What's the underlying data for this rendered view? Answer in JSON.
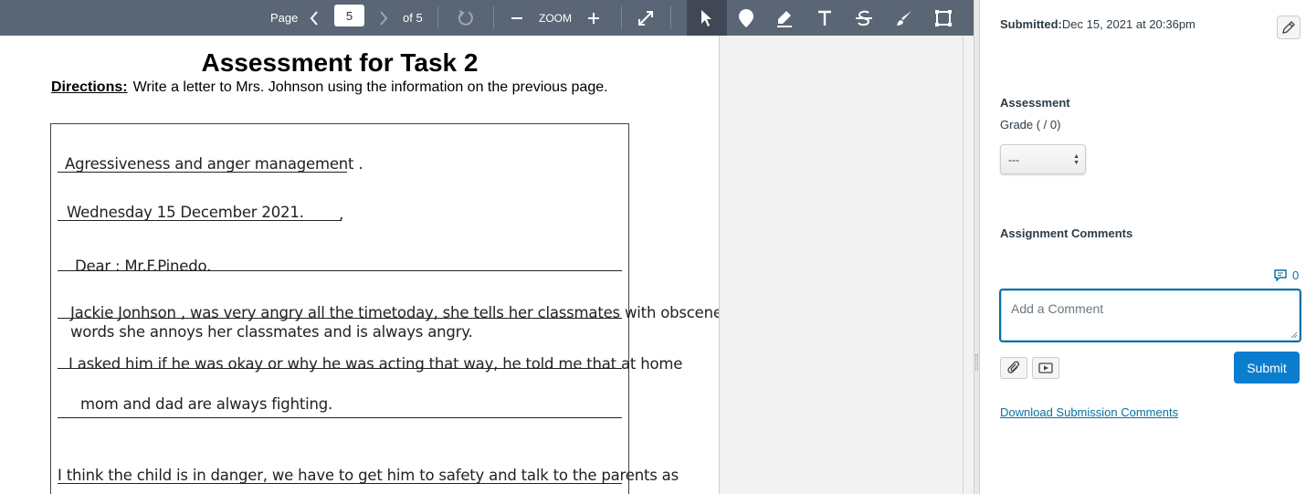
{
  "toolbar": {
    "page_label": "Page",
    "current_page": "5",
    "of_pages": "of 5",
    "zoom_label": "ZOOM"
  },
  "document": {
    "title": "Assessment for Task 2",
    "directions_label": "Directions:",
    "directions_text": "Write a letter to Mrs. Johnson using the information on the previous page.",
    "lines": [
      "Agressiveness and  anger management .",
      "Wednesday 15 December 2021.",
      ",",
      "Dear : Mr.F.Pinedo.",
      "Jackie Jonhson , was very angry all the timetoday, she tells her classmates with obscenes",
      "words she annoys her classmates and is always angry.",
      "I asked him if he was okay or why he was acting that way, he told me that at home",
      "mom and dad are always fighting.",
      "I think the child is in danger, we have to get him to safety and talk to the parents as"
    ]
  },
  "panel": {
    "submitted_label": "Submitted:",
    "submitted_value": "Dec 15, 2021 at 20:36pm",
    "assessment_heading": "Assessment",
    "grade_label": "Grade ( / 0)",
    "grade_value": "---",
    "comments_heading": "Assignment Comments",
    "comment_count": "0",
    "comment_placeholder": "Add a Comment",
    "submit_label": "Submit",
    "download_link": "Download Submission Comments"
  },
  "colors": {
    "toolbar": "#5a6675",
    "toolbar_active": "#3f4854",
    "link": "#0770a3",
    "submit": "#0b7dcf"
  },
  "icons": [
    "chevron-left-icon",
    "chevron-right-icon",
    "rotate-icon",
    "zoom-out-icon",
    "zoom-in-icon",
    "fullscreen-icon",
    "pointer-icon",
    "pin-icon",
    "highlight-icon",
    "text-icon",
    "strikeout-icon",
    "freedraw-icon",
    "area-icon",
    "pencil-icon",
    "comment-icon",
    "attach-icon",
    "media-icon"
  ]
}
